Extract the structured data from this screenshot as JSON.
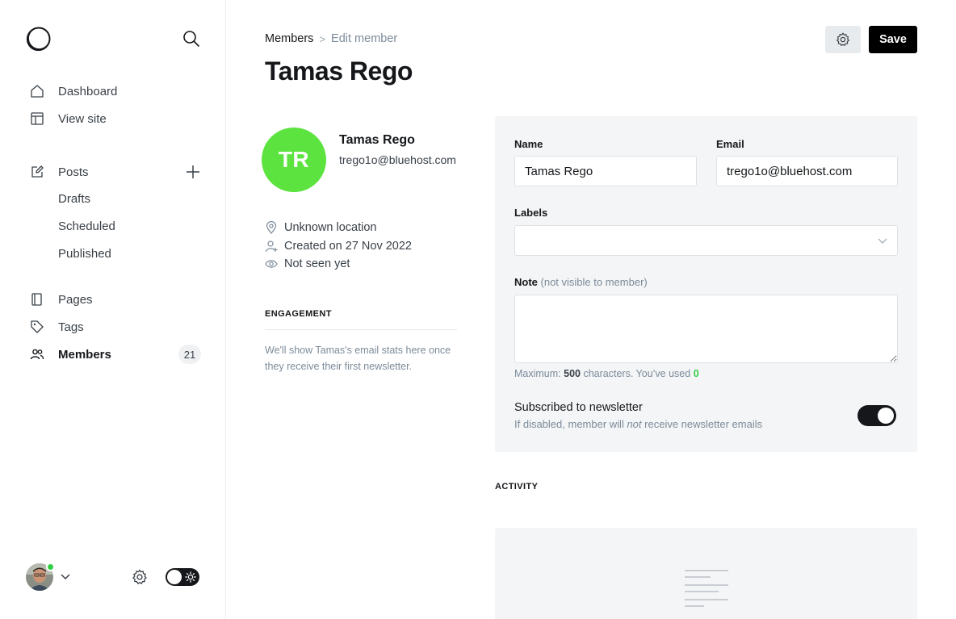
{
  "sidebar": {
    "nav": {
      "dashboard": "Dashboard",
      "view_site": "View site",
      "posts": "Posts",
      "drafts": "Drafts",
      "scheduled": "Scheduled",
      "published": "Published",
      "pages": "Pages",
      "tags": "Tags",
      "members": "Members",
      "members_count": "21"
    },
    "icons": [
      "logo-icon",
      "search-icon",
      "home-icon",
      "layout-icon",
      "edit-icon",
      "plus-icon",
      "page-icon",
      "tag-icon",
      "users-icon",
      "chevron-down-icon",
      "gear-icon",
      "sun-icon"
    ]
  },
  "header": {
    "breadcrumb_root": "Members",
    "breadcrumb_sep": ">",
    "breadcrumb_current": "Edit member",
    "title": "Tamas Rego",
    "save_label": "Save"
  },
  "member": {
    "initials": "TR",
    "name": "Tamas Rego",
    "email": "trego1o@bluehost.com",
    "location": "Unknown location",
    "created": "Created on 27 Nov 2022",
    "seen": "Not seen yet",
    "avatar_color": "#5de33f"
  },
  "engagement": {
    "label": "ENGAGEMENT",
    "text": "We'll show Tamas's email stats here once they receive their first newsletter."
  },
  "form": {
    "name_label": "Name",
    "name_value": "Tamas Rego",
    "email_label": "Email",
    "email_value": "trego1o@bluehost.com",
    "labels_label": "Labels",
    "note_label": "Note",
    "note_hint": "(not visible to member)",
    "note_value": "",
    "count_prefix": "Maximum:",
    "count_max": "500",
    "count_middle": "characters. You’ve used",
    "count_used": "0",
    "newsletter_title": "Subscribed to newsletter",
    "newsletter_desc_pre": "If disabled, member will",
    "newsletter_desc_em": "not",
    "newsletter_desc_post": "receive newsletter emails",
    "newsletter_subscribed": true
  },
  "activity": {
    "label": "ACTIVITY"
  },
  "colors": {
    "accent_green": "#30cf43",
    "dark": "#15171a",
    "panel_bg": "#f4f5f6"
  }
}
